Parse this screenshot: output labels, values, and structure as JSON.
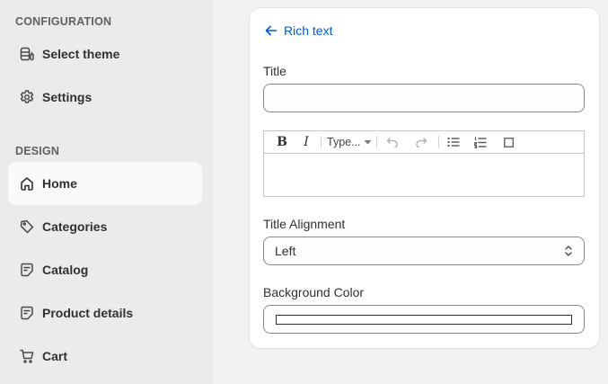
{
  "sidebar": {
    "config_heading": "CONFIGURATION",
    "design_heading": "DESIGN",
    "config_items": [
      {
        "label": "Select theme",
        "icon": "theme-icon"
      },
      {
        "label": "Settings",
        "icon": "gear-icon"
      }
    ],
    "design_items": [
      {
        "label": "Home",
        "icon": "home-icon",
        "active": true
      },
      {
        "label": "Categories",
        "icon": "tag-icon"
      },
      {
        "label": "Catalog",
        "icon": "catalog-icon"
      },
      {
        "label": "Product details",
        "icon": "product-icon"
      },
      {
        "label": "Cart",
        "icon": "cart-icon"
      }
    ]
  },
  "panel": {
    "back_label": "Rich text",
    "title_label": "Title",
    "title_value": "",
    "editor": {
      "bold": "B",
      "italic": "I",
      "type_dropdown": "Type...",
      "content": ""
    },
    "alignment_label": "Title Alignment",
    "alignment_value": "Left",
    "background_label": "Background Color",
    "background_value": "#ffffff"
  },
  "colors": {
    "accent": "#005bd3",
    "sidebar_bg": "#ebebeb",
    "active_item_bg": "#fafafa"
  }
}
